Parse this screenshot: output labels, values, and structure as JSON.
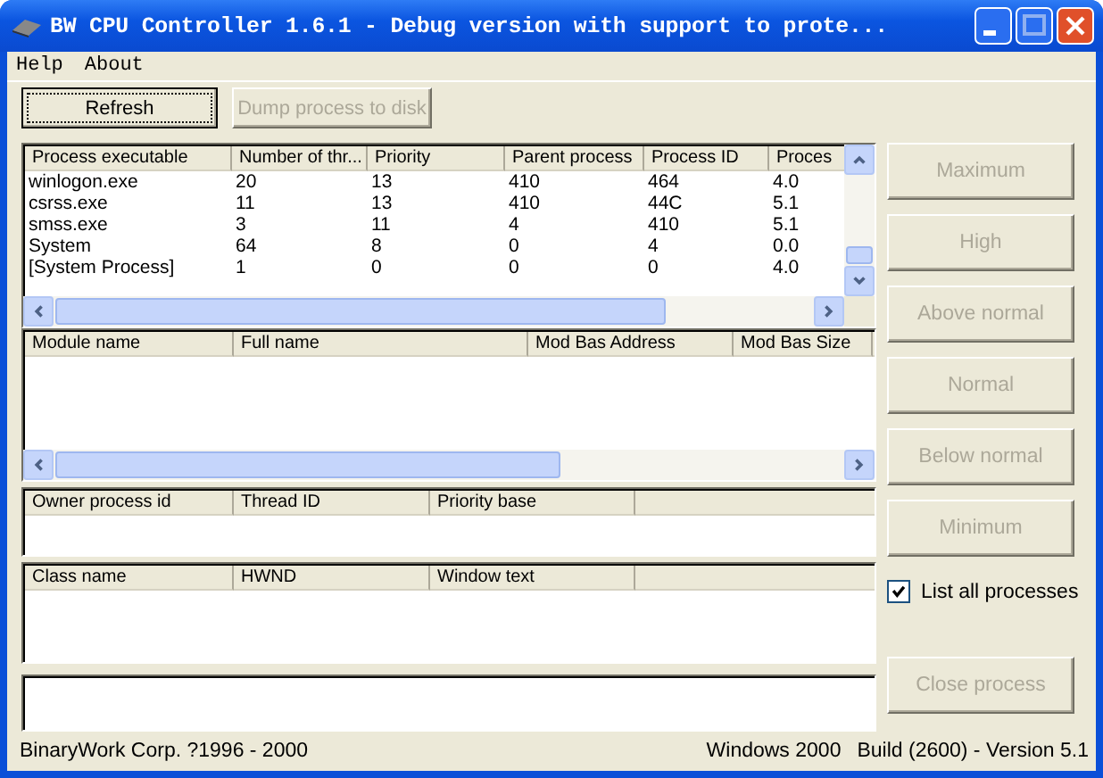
{
  "window": {
    "title": "BW CPU Controller 1.6.1 - Debug version with support to prote..."
  },
  "menu": [
    "Help",
    "About"
  ],
  "toolbar": [
    {
      "label": "Refresh",
      "disabled": false
    },
    {
      "label": "Dump process to disk",
      "disabled": true
    }
  ],
  "process_list": {
    "columns": [
      "Process executable",
      "Number of thr...",
      "Priority",
      "Parent process",
      "Process ID",
      "Proces"
    ],
    "rows": [
      [
        "winlogon.exe",
        "20",
        "13",
        "410",
        "464",
        "4.0"
      ],
      [
        "csrss.exe",
        "11",
        "13",
        "410",
        "44C",
        "5.1"
      ],
      [
        "smss.exe",
        "3",
        "11",
        "4",
        "410",
        "5.1"
      ],
      [
        "System",
        "64",
        "8",
        "0",
        "4",
        "0.0"
      ],
      [
        "[System Process]",
        "1",
        "0",
        "0",
        "0",
        "4.0"
      ]
    ]
  },
  "module_list": {
    "columns": [
      "Module name",
      "Full name",
      "Mod Bas Address",
      "Mod Bas Size"
    ]
  },
  "thread_list": {
    "columns": [
      "Owner process id",
      "Thread ID",
      "Priority base"
    ]
  },
  "window_list": {
    "columns": [
      "Class name",
      "HWND",
      "Window text"
    ]
  },
  "priority_buttons": [
    {
      "label": "Maximum",
      "disabled": true
    },
    {
      "label": "High",
      "disabled": true
    },
    {
      "label": "Above normal",
      "disabled": true
    },
    {
      "label": "Normal",
      "disabled": true
    },
    {
      "label": "Below normal",
      "disabled": true
    },
    {
      "label": "Minimum",
      "disabled": true
    }
  ],
  "list_all_processes": {
    "label": "List all processes",
    "checked": true
  },
  "close_button": {
    "label": "Close process",
    "disabled": true
  },
  "status_bar": {
    "left": "BinaryWork Corp. ?1996 - 2000",
    "os": "Windows 2000",
    "build": "Build (2600) - Version 5.1"
  }
}
